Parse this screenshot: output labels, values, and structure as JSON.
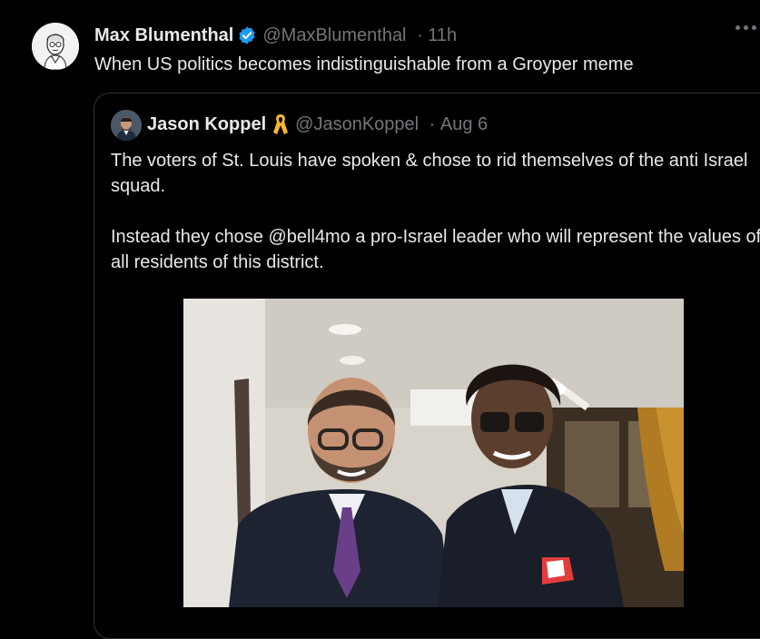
{
  "tweet": {
    "author_name": "Max Blumenthal",
    "author_handle": "@MaxBlumenthal",
    "time": "11h",
    "text": "When US politics becomes indistinguishable from a Groyper meme"
  },
  "quote": {
    "author_name": "Jason Koppel",
    "author_handle": "@JasonKoppel",
    "time": "Aug 6",
    "paragraph1": "The voters of St. Louis have spoken & chose to rid themselves of the anti Israel squad.",
    "paragraph2": "Instead they chose @bell4mo a pro-Israel leader who will represent the values of all residents of this district."
  },
  "colors": {
    "background": "#000000",
    "text": "#e7e9ea",
    "muted": "#71767b",
    "verified": "#1d9bf0",
    "ribbon": "#f5b82e",
    "border": "#2f3336"
  },
  "icons": [
    "verified-badge-icon",
    "yellow-ribbon-icon",
    "more-options-icon"
  ]
}
